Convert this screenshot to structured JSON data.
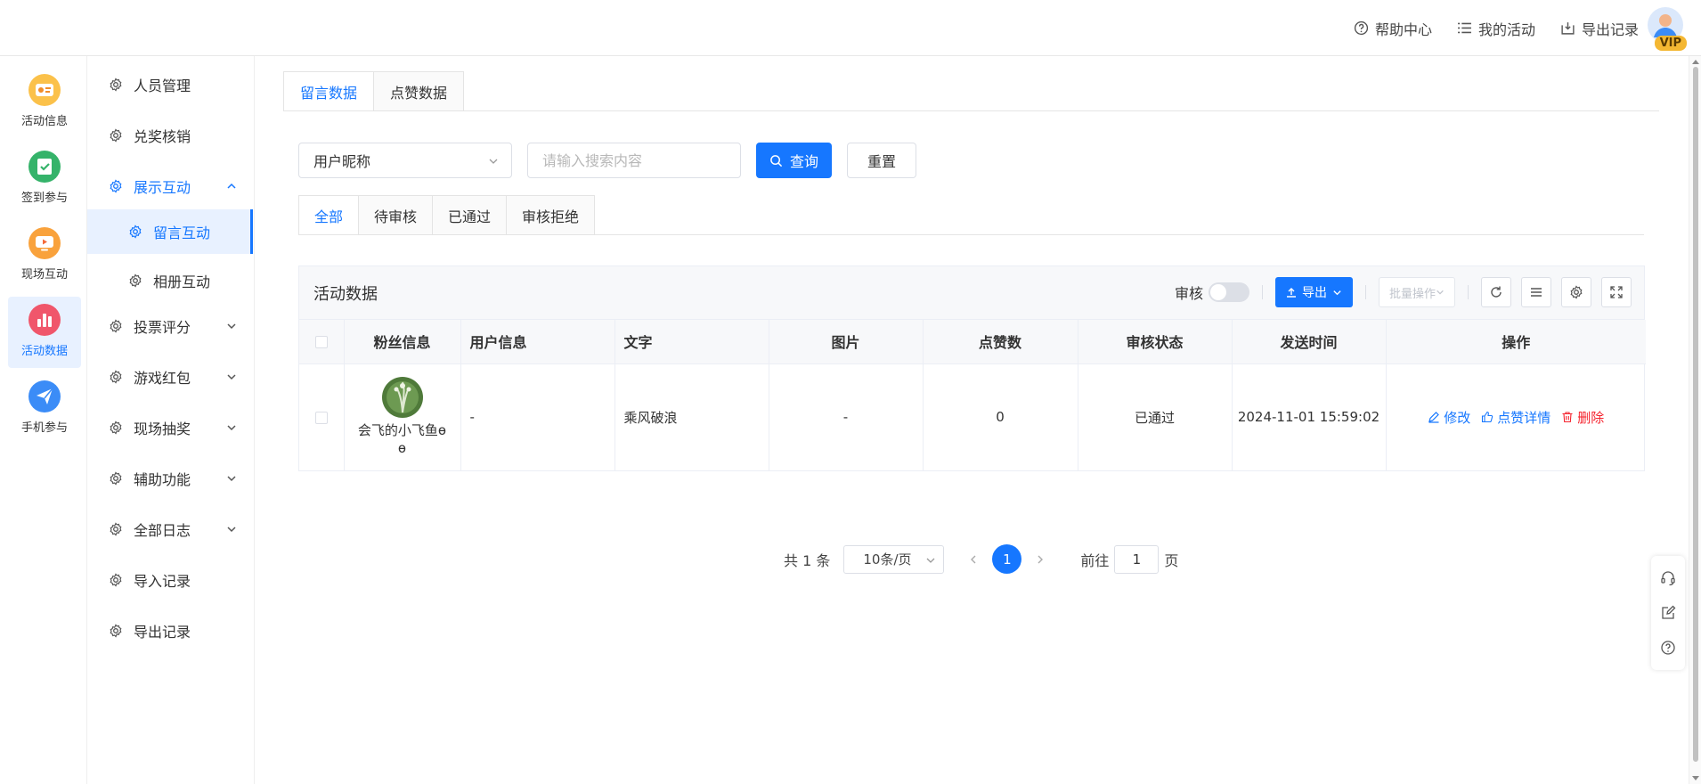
{
  "header": {
    "nav": [
      {
        "label": "帮助中心",
        "icon": "help-circle-icon"
      },
      {
        "label": "我的活动",
        "icon": "list-icon"
      },
      {
        "label": "导出记录",
        "icon": "download-box-icon"
      }
    ],
    "vip_badge": "VIP"
  },
  "rail": {
    "items": [
      {
        "label": "活动信息",
        "icon": "activity-info-icon",
        "color": "#f7a531"
      },
      {
        "label": "签到参与",
        "icon": "checkin-icon",
        "color": "#3cb371"
      },
      {
        "label": "现场互动",
        "icon": "live-interaction-icon",
        "color": "#f7a531"
      },
      {
        "label": "活动数据",
        "icon": "bar-chart-icon",
        "color": "#f0566b",
        "active": true
      },
      {
        "label": "手机参与",
        "icon": "paper-plane-icon",
        "color": "#3b8cf7"
      }
    ]
  },
  "menu": {
    "items": [
      {
        "label": "人员管理"
      },
      {
        "label": "兑奖核销"
      },
      {
        "label": "展示互动",
        "open": true
      },
      {
        "label": "留言互动",
        "sub": true,
        "active": true
      },
      {
        "label": "相册互动",
        "sub": true
      },
      {
        "label": "投票评分"
      },
      {
        "label": "游戏红包"
      },
      {
        "label": "现场抽奖"
      },
      {
        "label": "辅助功能"
      },
      {
        "label": "全部日志"
      },
      {
        "label": "导入记录"
      },
      {
        "label": "导出记录"
      }
    ]
  },
  "main": {
    "tabs": [
      {
        "label": "留言数据",
        "active": true
      },
      {
        "label": "点赞数据"
      }
    ],
    "filter": {
      "field_select": "用户昵称",
      "search_placeholder": "请输入搜索内容",
      "query_label": "查询",
      "reset_label": "重置"
    },
    "status_tabs": [
      {
        "label": "全部",
        "active": true
      },
      {
        "label": "待审核"
      },
      {
        "label": "已通过"
      },
      {
        "label": "审核拒绝"
      }
    ],
    "panel": {
      "title": "活动数据",
      "audit_label": "审核",
      "audit_on": false,
      "export_label": "导出",
      "batch_label": "批量操作"
    },
    "table": {
      "columns": [
        "粉丝信息",
        "用户信息",
        "文字",
        "图片",
        "点赞数",
        "审核状态",
        "发送时间",
        "操作"
      ],
      "rows": [
        {
          "fan_name": "会飞的小飞鱼ɵ ɵ",
          "user_info": "-",
          "text": "乘风破浪",
          "image": "-",
          "likes": "0",
          "status": "已通过",
          "sent_time": "2024-11-01 15:59:02",
          "ops": {
            "edit": "修改",
            "like_detail": "点赞详情",
            "delete": "删除"
          }
        }
      ]
    },
    "pagination": {
      "total": "共 1 条",
      "page_size": "10条/页",
      "current_page": "1",
      "goto_prefix": "前往",
      "goto_value": "1",
      "goto_suffix": "页"
    }
  },
  "colors": {
    "primary": "#1677ff",
    "danger": "#f5222d",
    "active_bg": "#e8f1ff"
  }
}
